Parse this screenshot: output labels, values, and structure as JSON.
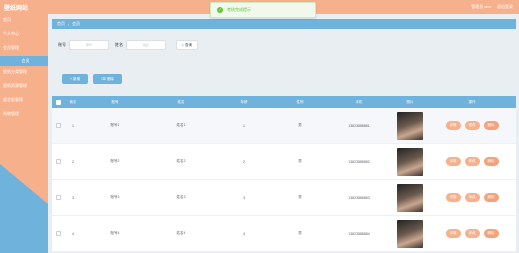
{
  "header": {
    "brand": "壁纸网站",
    "admin_label": "管理员 abo",
    "logout_label": "退出登录"
  },
  "toast": {
    "message": "考核完成提示"
  },
  "sidebar": {
    "items": [
      {
        "label": "首页"
      },
      {
        "label": "个人中心"
      },
      {
        "label": "会员管理",
        "active": true
      },
      {
        "label": "会员"
      },
      {
        "label": "壁纸分类管理"
      },
      {
        "label": "壁纸资源管理"
      },
      {
        "label": "留言板管理"
      },
      {
        "label": "系统管理"
      }
    ]
  },
  "breadcrumb": {
    "home_label": "首页",
    "current_label": "会员"
  },
  "search": {
    "no_label": "账号",
    "no_placeholder": "账号",
    "name_label": "姓名",
    "name_placeholder": "姓名",
    "button_label": "查询"
  },
  "actions": {
    "add_label": "新增",
    "delete_label": "删除"
  },
  "table": {
    "headers": [
      "索引",
      "账号",
      "姓名",
      "年龄",
      "性别",
      "手机",
      "照片",
      "操作"
    ],
    "rows": [
      {
        "idx": "1",
        "no": "账号1",
        "name": "姓名1",
        "age": "1",
        "sex": "男",
        "phone": "13823888881"
      },
      {
        "idx": "2",
        "no": "账号2",
        "name": "姓名2",
        "age": "2",
        "sex": "男",
        "phone": "13823888882"
      },
      {
        "idx": "3",
        "no": "账号3",
        "name": "姓名3",
        "age": "3",
        "sex": "男",
        "phone": "13823888883"
      },
      {
        "idx": "4",
        "no": "账号4",
        "name": "姓名4",
        "age": "4",
        "sex": "男",
        "phone": "13823888884"
      }
    ],
    "ops": {
      "detail": "详情",
      "edit": "修改",
      "delete": "删除"
    }
  },
  "colors": {
    "header": "#f7b08c",
    "accent": "#6fb2dc",
    "button": "#f7b08c"
  }
}
